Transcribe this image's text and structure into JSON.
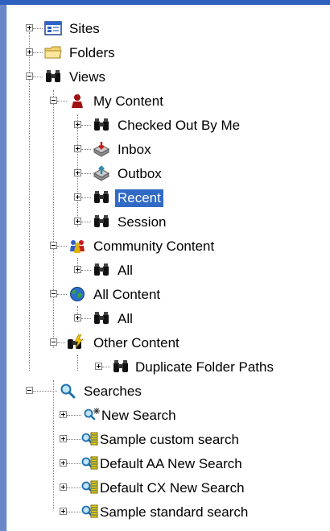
{
  "tree": {
    "sites": {
      "label": "Sites",
      "icon": "sites-window-icon",
      "state": "collapsed"
    },
    "folders": {
      "label": "Folders",
      "icon": "folder-icon",
      "state": "collapsed"
    },
    "views": {
      "label": "Views",
      "icon": "binoculars-icon",
      "state": "expanded",
      "my_content": {
        "label": "My Content",
        "icon": "user-icon",
        "state": "expanded",
        "items": [
          {
            "label": "Checked Out By Me",
            "icon": "binoculars-icon"
          },
          {
            "label": "Inbox",
            "icon": "inbox-icon"
          },
          {
            "label": "Outbox",
            "icon": "outbox-icon"
          },
          {
            "label": "Recent",
            "icon": "binoculars-icon",
            "selected": true
          },
          {
            "label": "Session",
            "icon": "binoculars-icon"
          }
        ]
      },
      "community_content": {
        "label": "Community Content",
        "icon": "group-icon",
        "state": "expanded",
        "items": [
          {
            "label": "All",
            "icon": "binoculars-icon"
          }
        ]
      },
      "all_content": {
        "label": "All Content",
        "icon": "globe-icon",
        "state": "expanded",
        "items": [
          {
            "label": "All",
            "icon": "binoculars-icon"
          }
        ]
      },
      "other_content": {
        "label": "Other Content",
        "icon": "binoculars-lightning-icon",
        "state": "expanded",
        "items": [
          {
            "label": "Duplicate Folder Paths",
            "icon": "binoculars-icon"
          }
        ]
      }
    },
    "searches": {
      "label": "Searches",
      "icon": "magnifier-icon",
      "state": "expanded",
      "items": [
        {
          "label": "New Search",
          "icon": "new-search-icon"
        },
        {
          "label": "Sample custom search",
          "icon": "saved-search-icon"
        },
        {
          "label": "Default AA New Search",
          "icon": "saved-search-icon"
        },
        {
          "label": "Default CX New Search",
          "icon": "saved-search-icon"
        },
        {
          "label": "Sample standard search",
          "icon": "saved-search-icon"
        }
      ]
    }
  },
  "colors": {
    "selection": "#316ac5",
    "frame_accent": "#2f5fbf"
  }
}
